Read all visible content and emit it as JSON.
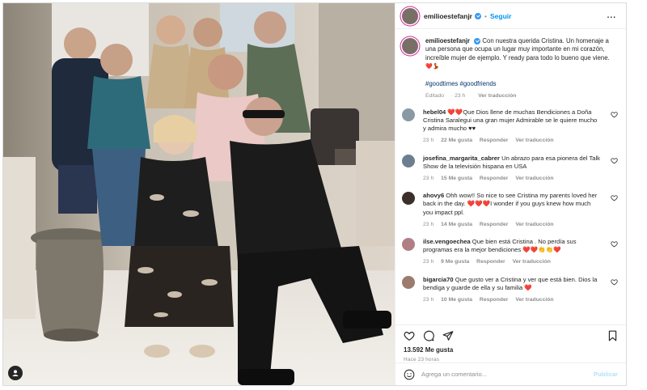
{
  "header": {
    "username": "emilioestefanjr",
    "separator": "•",
    "follow_label": "Seguir",
    "more_label": "..."
  },
  "caption": {
    "username": "emilioestefanjr",
    "text": "Con nuestra querida Cristina. Un homenaje a una persona que ocupa un lugar muy importante en mi corazón, increíble mujer de ejemplo. Y ready para todo lo bueno que viene.",
    "emojis": "❤️💃",
    "hashtags": [
      "#goodtimes",
      "#goodfriends"
    ],
    "edited": "Editado",
    "age": "23 h",
    "translate": "Ver traducción"
  },
  "comments": [
    {
      "user": "hebel04",
      "text": "❤️❤️Que Dios llene de muchas Bendiciones a Doña Cristina Saralegui una gran mujer Admirable se le quiere mucho y admira mucho ♥♥",
      "age": "23 h",
      "likes": "22 Me gusta",
      "reply": "Responder",
      "translate": "Ver traducción"
    },
    {
      "user": "josefina_margarita_cabrer",
      "text": "Un abrazo para esa pionera del Talk Show de la televisión hispana en USA",
      "age": "23 h",
      "likes": "15 Me gusta",
      "reply": "Responder",
      "translate": "Ver traducción"
    },
    {
      "user": "ahovy6",
      "text": "Ohh wow!! So nice to see Cristina my parents loved her back in the day. ❤️❤️❤️I wonder if you guys knew how much you impact ppl.",
      "age": "23 h",
      "likes": "14 Me gusta",
      "reply": "Responder",
      "translate": "Ver traducción"
    },
    {
      "user": "ilse.vengoechea",
      "text": "Que bien está Cristina . No perdía sus programas era la mejor bendiciones ❤️❤️👏👏❤️",
      "age": "23 h",
      "likes": "9 Me gusta",
      "reply": "Responder",
      "translate": "Ver traducción"
    },
    {
      "user": "bigarcia70",
      "text": "Que gusto ver a Cristina y ver que está bien. Dios la bendiga y guarde de ella y su familia ❤️",
      "age": "23 h",
      "likes": "10 Me gusta",
      "reply": "Responder",
      "translate": "Ver traducción"
    }
  ],
  "post": {
    "likes": "13.592 Me gusta",
    "time": "Hace 23 horas",
    "comment_placeholder": "Agrega un comentario...",
    "publish_label": "Publicar"
  },
  "icons": [
    "heart-icon",
    "comment-icon",
    "share-icon",
    "bookmark-icon",
    "emoji-icon",
    "user-tag-icon",
    "verified-badge-icon",
    "more-icon"
  ],
  "colors": {
    "accent": "#0095f6",
    "verified": "#3897f0",
    "hashtag": "#00376b",
    "muted": "#8e8e8e",
    "border": "#dbdbdb"
  }
}
